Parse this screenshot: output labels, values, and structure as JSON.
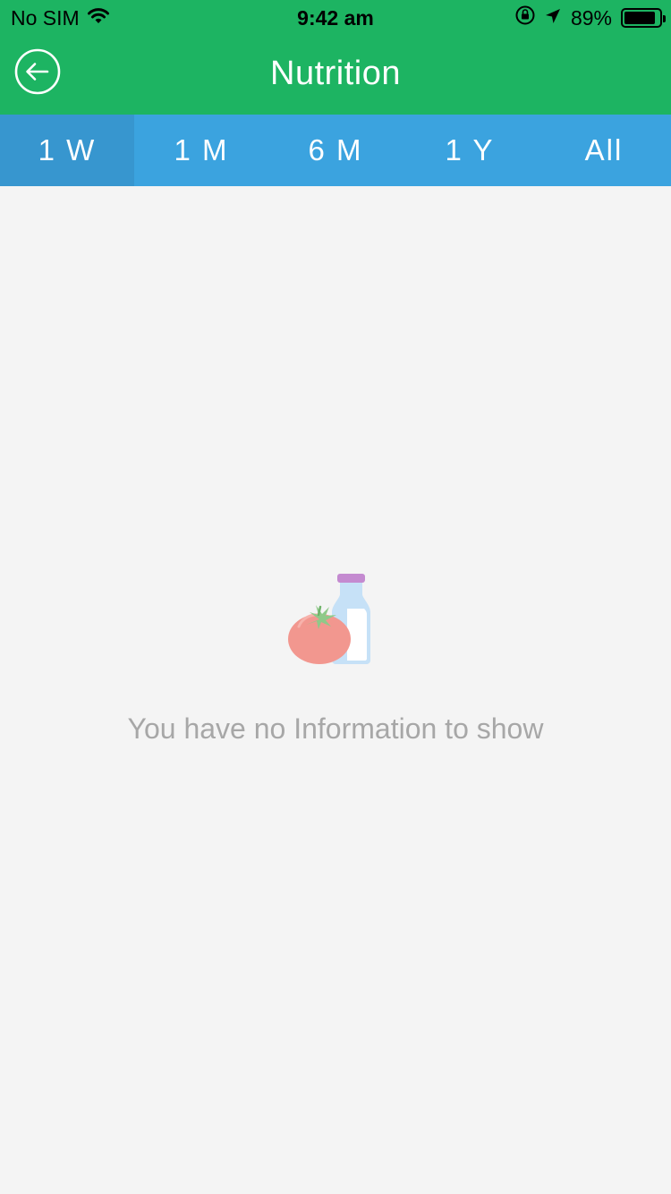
{
  "status_bar": {
    "carrier": "No SIM",
    "time": "9:42 am",
    "battery_percent": "89%",
    "battery_level": 0.89
  },
  "nav": {
    "title": "Nutrition",
    "back_icon": "back-arrow-circle-icon"
  },
  "tabs": [
    {
      "label": "1 W",
      "active": true
    },
    {
      "label": "1 M",
      "active": false
    },
    {
      "label": "6 M",
      "active": false
    },
    {
      "label": "1 Y",
      "active": false
    },
    {
      "label": "All",
      "active": false
    }
  ],
  "empty_state": {
    "icon": "tomato-bottle-icon",
    "message": "You have no Information to show"
  },
  "colors": {
    "header_green": "#1db462",
    "tab_blue": "#3ba3df",
    "tab_active_blue": "#3796cf",
    "background": "#f4f4f4",
    "empty_text": "#a7a7a7"
  }
}
